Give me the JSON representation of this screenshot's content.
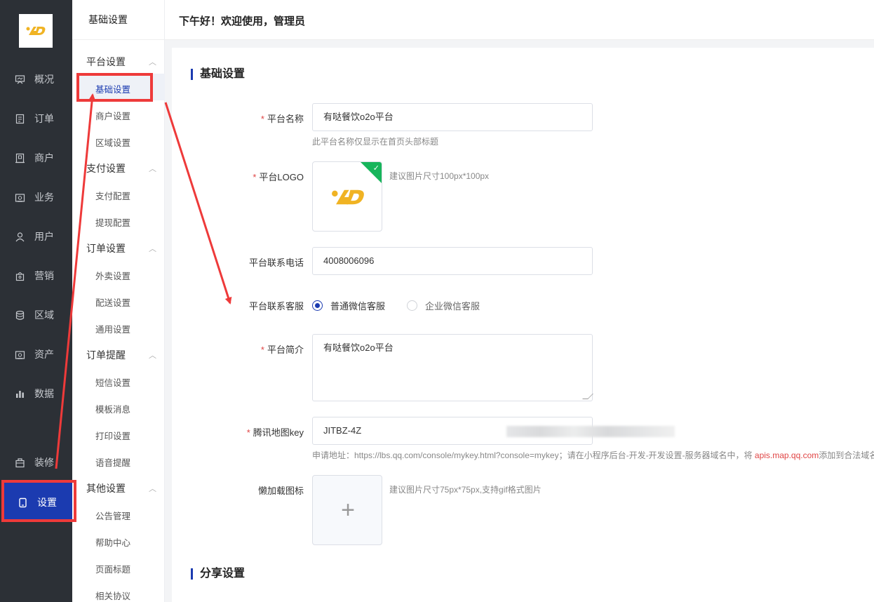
{
  "nav": {
    "items": [
      {
        "label": "概况",
        "icon": "presentation-icon"
      },
      {
        "label": "订单",
        "icon": "document-icon"
      },
      {
        "label": "商户",
        "icon": "shop-icon"
      },
      {
        "label": "业务",
        "icon": "briefcase-icon"
      },
      {
        "label": "用户",
        "icon": "user-icon"
      },
      {
        "label": "营销",
        "icon": "gift-icon"
      },
      {
        "label": "区域",
        "icon": "database-icon"
      },
      {
        "label": "资产",
        "icon": "wallet-icon"
      },
      {
        "label": "数据",
        "icon": "bar-chart-icon"
      },
      {
        "label": "装修",
        "icon": "bag-icon"
      },
      {
        "label": "设置",
        "icon": "tablet-icon"
      }
    ],
    "active": "设置"
  },
  "submenu": {
    "title": "基础设置",
    "groups": [
      {
        "label": "平台设置",
        "items": [
          "基础设置",
          "商户设置",
          "区域设置"
        ]
      },
      {
        "label": "支付设置",
        "items": [
          "支付配置",
          "提现配置"
        ]
      },
      {
        "label": "订单设置",
        "items": [
          "外卖设置",
          "配送设置",
          "通用设置"
        ]
      },
      {
        "label": "订单提醒",
        "items": [
          "短信设置",
          "模板消息",
          "打印设置",
          "语音提醒"
        ]
      },
      {
        "label": "其他设置",
        "items": [
          "公告管理",
          "帮助中心",
          "页面标题",
          "相关协议"
        ]
      }
    ],
    "active_item": "基础设置"
  },
  "header": {
    "greeting": "下午好！欢迎使用，管理员"
  },
  "form": {
    "section_title": "基础设置",
    "platform_name": {
      "label": "平台名称",
      "value": "有哒餐饮o2o平台",
      "hint": "此平台名称仅显示在首页头部标题"
    },
    "platform_logo": {
      "label": "平台LOGO",
      "hint": "建议图片尺寸100px*100px"
    },
    "phone": {
      "label": "平台联系电话",
      "value": "4008006096"
    },
    "service": {
      "label": "平台联系客服",
      "options": [
        "普通微信客服",
        "企业微信客服"
      ],
      "selected": "普通微信客服"
    },
    "intro": {
      "label": "平台简介",
      "value": "有哒餐饮o2o平台"
    },
    "map_key": {
      "label": "腾讯地图key",
      "value": "JITBZ-4Z",
      "hint_prefix": "申请地址：https://lbs.qq.com/console/mykey.html?console=mykey；请在小程序后台-开发-开发设置-服务器域名中，将 ",
      "hint_domain": "apis.map.qq.com",
      "hint_suffix": "添加到合法域名"
    },
    "lazy_icon": {
      "label": "懒加载图标",
      "hint": "建议图片尺寸75px*75px,支持gif格式图片",
      "plus": "+"
    },
    "share_title": "分享设置"
  },
  "colors": {
    "accent": "#1b3bb0",
    "nav_bg": "#2c3036",
    "annotation": "#ee3a3a",
    "success": "#17b55b"
  }
}
